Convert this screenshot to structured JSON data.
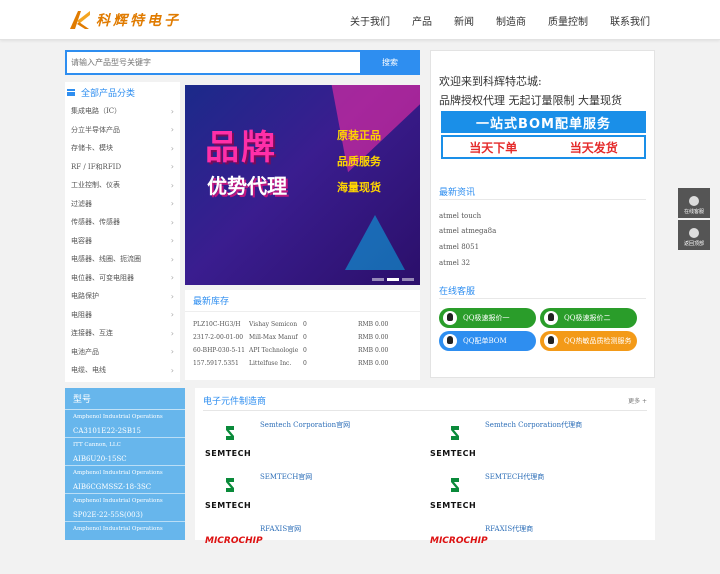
{
  "header": {
    "logo_text": "科辉特电子",
    "nav": [
      "关于我们",
      "产品",
      "新闻",
      "制造商",
      "质量控制",
      "联系我们"
    ]
  },
  "search": {
    "placeholder": "请输入产品型号关键字",
    "button": "搜索"
  },
  "categories": {
    "title": "全部产品分类",
    "items": [
      "集成电路（IC）",
      "分立半导体产品",
      "存储卡、模块",
      "RF / IF和RFID",
      "工业控制、仪表",
      "过滤器",
      "传感器、传感器",
      "电容器",
      "电感器、线圈、扼流圈",
      "电位器、可变电阻器",
      "电路保护",
      "电阻器",
      "连接器、互连",
      "电池产品",
      "电缆、电线"
    ]
  },
  "banner": {
    "big": "品牌",
    "mid": "优势代理",
    "lines": [
      "原装正品",
      "品质服务",
      "海量现货"
    ]
  },
  "stock": {
    "title": "最新库存",
    "rows": [
      [
        "PLZ10C-HG3/H",
        "Vishay Semicon",
        "0",
        "RMB 0.00"
      ],
      [
        "2317-2-00-01-00",
        "Mill-Max Manuf",
        "0",
        "RMB 0.00"
      ],
      [
        "60-BHP-030-5-11",
        "API Technologie",
        "0",
        "RMB 0.00"
      ],
      [
        "157.5917.5351",
        "Littelfuse Inc.",
        "0",
        "RMB 0.00"
      ]
    ]
  },
  "welcome": {
    "line1": "欢迎来到科辉特芯城:",
    "line2": "品牌授权代理 无起订量限制 大量现货",
    "bom_top": "一站式BOM配单服务",
    "bom_left": "当天下单",
    "bom_right": "当天发货"
  },
  "news": {
    "title": "最新资讯",
    "items": [
      "atmel touch",
      "atmel atmega8a",
      "atmel 8051",
      "atmel 32"
    ]
  },
  "service": {
    "title": "在线客服",
    "buttons": [
      "QQ极速报价一",
      "QQ极速报价二",
      "QQ配单BOM",
      "QQ热敏品质检测服务"
    ]
  },
  "float_bar": [
    "在线客服",
    "返回顶部"
  ],
  "types": {
    "title": "型号",
    "entries": [
      {
        "pn": "",
        "mfr": "Amphenol Industrial Operations"
      },
      {
        "pn": "CA3101E22-2SB15",
        "mfr": "ITT Cannon, LLC"
      },
      {
        "pn": "AIB6U20-15SC",
        "mfr": "Amphenol Industrial Operations"
      },
      {
        "pn": "AIB6CGMSSZ-18-3SC",
        "mfr": "Amphenol Industrial Operations"
      },
      {
        "pn": "SP02E-22-55S(003)",
        "mfr": "Amphenol Industrial Operations"
      }
    ]
  },
  "manufacturers": {
    "title": "电子元件制造商",
    "more": "更多 +",
    "items": [
      {
        "logo": "SEMTECH",
        "name": "Semtech Corporation官网"
      },
      {
        "logo": "SEMTECH",
        "name": "Semtech Corporation代理商"
      },
      {
        "logo": "SEMTECH",
        "name": "SEMTECH官网"
      },
      {
        "logo": "SEMTECH",
        "name": "SEMTECH代理商"
      },
      {
        "logo": "MICROCHIP",
        "name": "RFAXIS官网"
      },
      {
        "logo": "MICROCHIP",
        "name": "RFAXIS代理商"
      }
    ]
  },
  "colors": {
    "accent": "#2e8ef0",
    "type_panel": "#67b6ec",
    "banner_pink": "#ff2fa8"
  }
}
